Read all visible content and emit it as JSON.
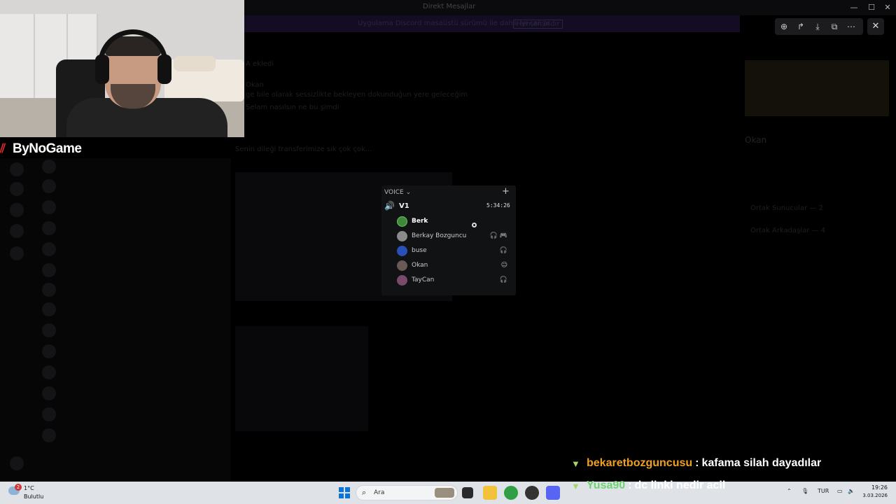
{
  "window": {
    "title": "Direkt Mesajlar"
  },
  "banner": {
    "text": "Uygulama Discord masaüstü sürümü ile daha iyi çalışır",
    "action": "Hemen indir"
  },
  "viewer": {
    "tools": [
      "zoom-in-icon",
      "share-icon",
      "download-icon",
      "open-external-icon",
      "more-icon"
    ],
    "close": "✕"
  },
  "brand": {
    "name": "ByNoGame",
    "accent": "#e02a2a"
  },
  "background_text": {
    "messages": [
      "A ekledi",
      "Okan",
      "ge bile olarak sessizlikte bekleyen dokunduğun yere geleceğim",
      "Selam nasılsın ne bu şimdi",
      "Senin dileği transferimize sık çok çok...",
      "Okan",
      "Ortak Sunucular — 2",
      "Ortak Arkadaşlar — 4"
    ]
  },
  "voice": {
    "header": "VOICE",
    "chevron": "⌄",
    "add": "+",
    "channel": "V1",
    "timer": "5:34:26",
    "members": [
      {
        "name": "Berk",
        "bold": true,
        "color": "#3c8a3a",
        "status": ""
      },
      {
        "name": "Berkay Bozguncu",
        "bold": false,
        "color": "#8a8a8a",
        "status": "🎧 🎮"
      },
      {
        "name": "buse",
        "bold": false,
        "color": "#2b4fb8",
        "status": "🎧"
      },
      {
        "name": "Okan",
        "bold": false,
        "color": "#6a5a55",
        "status": "☺"
      },
      {
        "name": "TayCan",
        "bold": false,
        "color": "#7a4a6a",
        "status": "🎧"
      }
    ]
  },
  "chat": [
    {
      "user": "bekaretbozguncusu",
      "user_color": "#f0a020",
      "message": "kafama silah dayadılar"
    },
    {
      "user": "Yusa90",
      "user_color": "#6fd36f",
      "message": "dc linki nedir acil"
    }
  ],
  "taskbar": {
    "weather": {
      "temp": "1°C",
      "desc": "Bulutlu",
      "badge": "2"
    },
    "search_placeholder": "Ara",
    "language": "TUR",
    "time": "19:26",
    "date": "3.03.2026"
  }
}
